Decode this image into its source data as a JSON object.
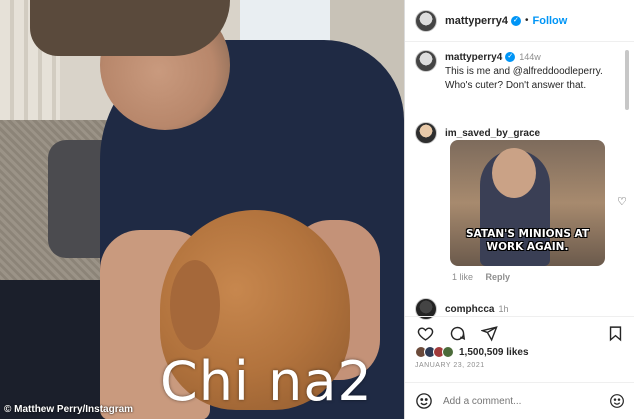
{
  "photo": {
    "credit": "© Matthew Perry/Instagram",
    "watermark": "Chi na2"
  },
  "post": {
    "username": "mattyperry4",
    "follow_label": "Follow",
    "separator": "•",
    "caption": {
      "username": "mattyperry4",
      "time": "144w",
      "text": "This is me and @alfreddoodleperry. Who's cuter? Don't answer that."
    },
    "comments": [
      {
        "username": "im_saved_by_grace",
        "meme_text": "SATAN'S MINIONS AT WORK AGAIN.",
        "likes": "1 like",
        "reply": "Reply"
      },
      {
        "username": "comphcca",
        "time": "1h"
      }
    ],
    "likes_count": "1,500,509 likes",
    "date": "JANUARY 23, 2021",
    "add_comment_placeholder": "Add a comment..."
  },
  "colors": {
    "accent": "#0095f6",
    "text": "#262626",
    "muted": "#8e8e8e",
    "border": "#dbdbdb"
  },
  "icons": {
    "verified": "verified-badge-icon",
    "heart": "heart-icon",
    "comment": "comment-icon",
    "share": "share-icon",
    "bookmark": "bookmark-icon",
    "emoji": "emoji-icon"
  }
}
